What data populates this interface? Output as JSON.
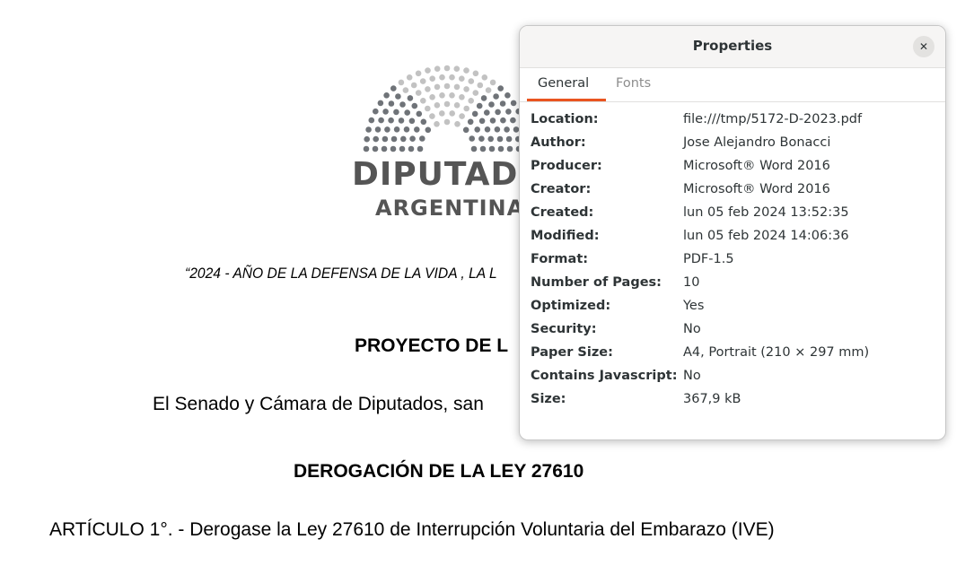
{
  "document": {
    "logo_line1": "DIPUTADOS",
    "logo_line2": "ARGENTINA",
    "motto": "“2024 - AÑO DE LA DEFENSA DE LA VIDA , LA L",
    "heading": "PROYECTO DE L",
    "preamble": "El Senado y Cámara de Diputados, san",
    "law_title": "DEROGACIÓN DE LA LEY 27610",
    "article": "ARTÍCULO 1°. - Derogase la Ley 27610 de Interrupción  Voluntaria del Embarazo (IVE)",
    "colors": {
      "logo_gray": "#555555",
      "seat_gray_light": "#c2c2c2",
      "seat_gray_dark": "#6f7378"
    }
  },
  "dialog": {
    "title": "Properties",
    "close_icon": "close-icon",
    "tabs": [
      {
        "label": "General",
        "active": true
      },
      {
        "label": "Fonts",
        "active": false
      }
    ],
    "accent_color": "#e95420",
    "properties": [
      {
        "label": "Location:",
        "value": "file:///tmp/5172-D-2023.pdf"
      },
      {
        "label": "Author:",
        "value": "Jose Alejandro Bonacci"
      },
      {
        "label": "Producer:",
        "value": "Microsoft® Word 2016"
      },
      {
        "label": "Creator:",
        "value": "Microsoft® Word 2016"
      },
      {
        "label": "Created:",
        "value": "lun 05 feb 2024 13:52:35"
      },
      {
        "label": "Modified:",
        "value": "lun 05 feb 2024 14:06:36"
      },
      {
        "label": "Format:",
        "value": "PDF-1.5"
      },
      {
        "label": "Number of Pages:",
        "value": "10"
      },
      {
        "label": "Optimized:",
        "value": "Yes"
      },
      {
        "label": "Security:",
        "value": "No"
      },
      {
        "label": "Paper Size:",
        "value": "A4, Portrait (210 × 297 mm)"
      },
      {
        "label": "Contains Javascript:",
        "value": "No"
      },
      {
        "label": "Size:",
        "value": "367,9 kB"
      }
    ]
  }
}
